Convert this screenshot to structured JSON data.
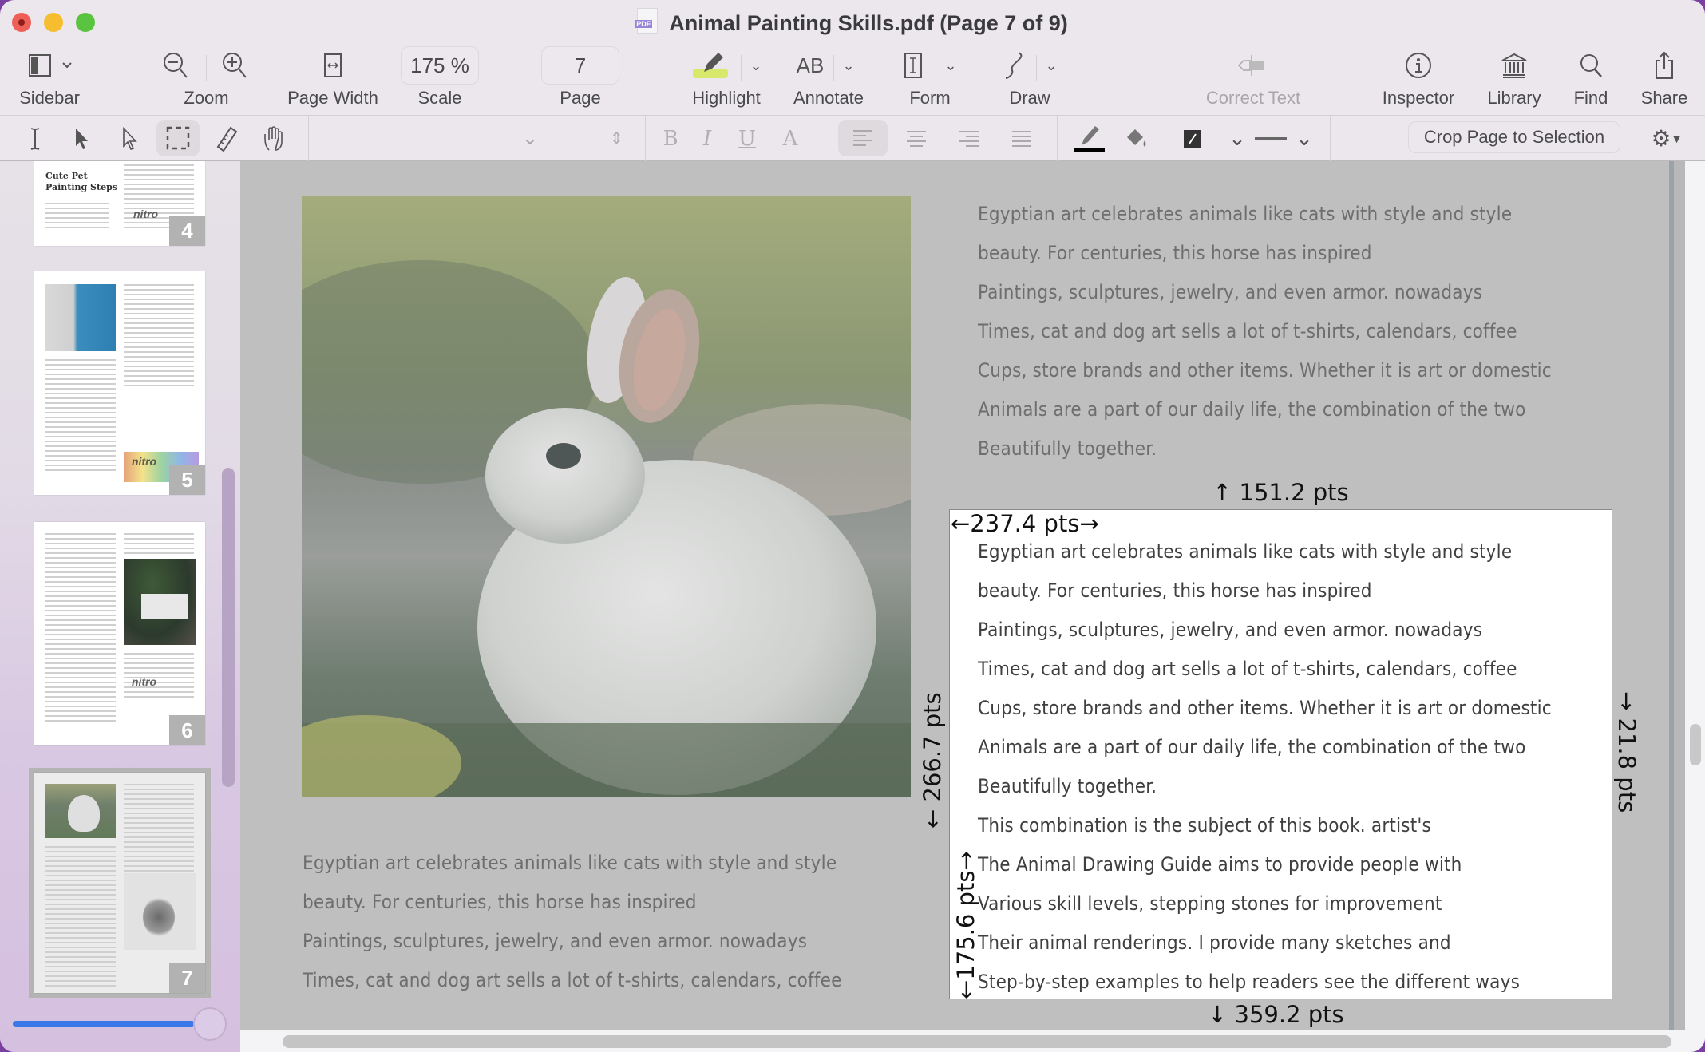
{
  "window": {
    "title": "Animal Painting Skills.pdf (Page 7 of 9)",
    "file_icon": "pdf-file-icon",
    "file_icon_badge": "PDF"
  },
  "toolbar": {
    "sidebar_label": "Sidebar",
    "zoom_label": "Zoom",
    "page_width_label": "Page Width",
    "scale_label": "Scale",
    "scale_value": "175 %",
    "page_label": "Page",
    "page_value": "7",
    "highlight_label": "Highlight",
    "highlight_color": "#d8e86a",
    "annotate_label": "Annotate",
    "annotate_glyph": "AB",
    "form_label": "Form",
    "draw_label": "Draw",
    "correct_text_label": "Correct Text",
    "inspector_label": "Inspector",
    "library_label": "Library",
    "find_label": "Find",
    "share_label": "Share"
  },
  "format_bar": {
    "font_select_value": "",
    "bold": "B",
    "italic": "I",
    "underline": "U",
    "text_style": "A",
    "stroke_color": "#000000",
    "crop_button": "Crop Page to Selection"
  },
  "sidebar": {
    "thumbnails": [
      {
        "page": "4",
        "heading": "Cute Pet Painting Steps",
        "watermark": "nitro"
      },
      {
        "page": "5",
        "watermark": "nitro"
      },
      {
        "page": "6",
        "watermark": "nitro"
      },
      {
        "page": "7",
        "selected": true
      }
    ],
    "thumbnail_size_fraction": 0.98
  },
  "document": {
    "right_column_lines": [
      "Egyptian art celebrates animals like cats with style and style",
      "beauty. For centuries, this horse has inspired",
      "Paintings, sculptures, jewelry, and even armor. nowadays",
      "Times, cat and dog art sells a lot of t-shirts, calendars, coffee",
      "Cups, store brands and other items. Whether it is art or domestic",
      "Animals are a part of our daily life, the combination of the two",
      "Beautifully together."
    ],
    "selected_lines": [
      "Egyptian art celebrates animals like cats with style and style",
      "beauty. For centuries, this horse has inspired",
      "Paintings, sculptures, jewelry, and even armor. nowadays",
      "Times, cat and dog art sells a lot of t-shirts, calendars, coffee",
      "Cups, store brands and other items. Whether it is art or domestic",
      "Animals are a part of our daily life, the combination of the two",
      "Beautifully together.",
      "This combination is the subject of this book. artist's",
      "The Animal Drawing Guide aims to provide people with",
      "Various skill levels, stepping stones for improvement",
      "Their animal renderings. I provide many sketches and",
      "Step-by-step examples to help readers see the different ways"
    ],
    "left_column_lines": [
      "Egyptian art celebrates animals like cats with style and style",
      "beauty. For centuries, this horse has inspired",
      "Paintings, sculptures, jewelry, and even armor. nowadays",
      "Times, cat and dog art sells a lot of t-shirts, calendars, coffee"
    ],
    "image_alt": "white rabbit on grass"
  },
  "measurements": {
    "top": "↑ 151.2 pts",
    "width": "←237.4 pts→",
    "left": "← 266.7 pts",
    "right": "→ 21.8 pts",
    "height": "←175.6 pts→",
    "bottom": "↓ 359.2 pts"
  }
}
